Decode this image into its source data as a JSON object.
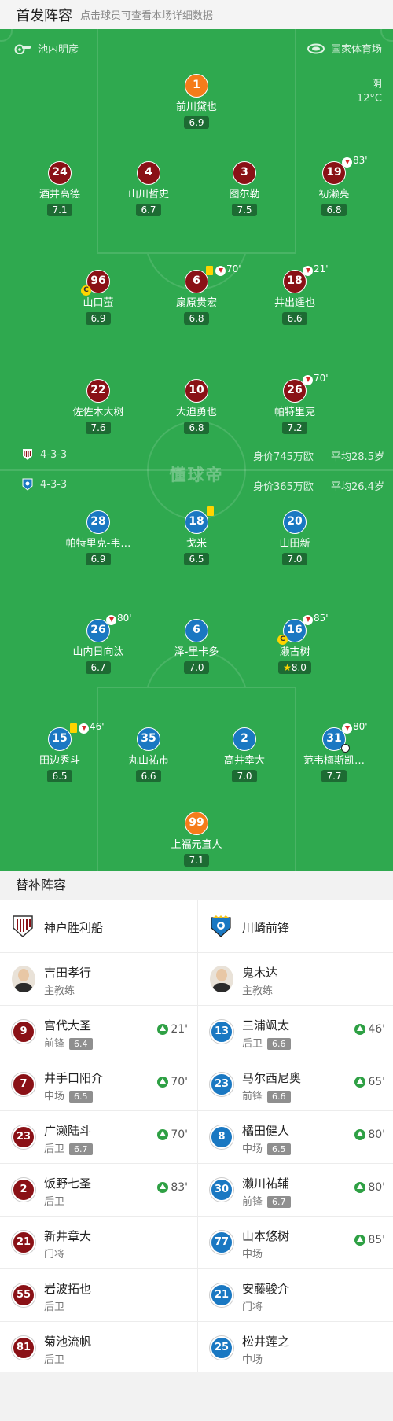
{
  "header": {
    "title": "首发阵容",
    "subtitle": "点击球员可查看本场详细数据"
  },
  "field": {
    "referee": "池内明彦",
    "stadium": "国家体育场",
    "weather": "阴",
    "temperature": "12°C",
    "home": {
      "formation": "4-3-3",
      "value": "身价745万欧",
      "age": "平均28.5岁"
    },
    "away": {
      "formation": "4-3-3",
      "value": "身价365万欧",
      "age": "平均26.4岁"
    },
    "watermark": "懂球帝"
  },
  "home_players": [
    {
      "num": "1",
      "name": "前川黛也",
      "rating": "6.9"
    },
    {
      "num": "24",
      "name": "酒井高德",
      "rating": "7.1"
    },
    {
      "num": "4",
      "name": "山川哲史",
      "rating": "6.7"
    },
    {
      "num": "3",
      "name": "图尔勒",
      "rating": "7.5"
    },
    {
      "num": "19",
      "name": "初濑亮",
      "rating": "6.8",
      "sub": "83'"
    },
    {
      "num": "96",
      "name": "山口萤",
      "rating": "6.9"
    },
    {
      "num": "6",
      "name": "扇原贵宏",
      "rating": "6.8",
      "sub": "70'"
    },
    {
      "num": "18",
      "name": "井出遥也",
      "rating": "6.6",
      "sub": "21'"
    },
    {
      "num": "22",
      "name": "佐佐木大树",
      "rating": "7.6"
    },
    {
      "num": "10",
      "name": "大迫勇也",
      "rating": "6.8"
    },
    {
      "num": "26",
      "name": "帕特里克",
      "rating": "7.2",
      "sub": "70'"
    }
  ],
  "away_players": [
    {
      "num": "28",
      "name": "帕特里克-韦…",
      "rating": "6.9"
    },
    {
      "num": "18",
      "name": "戈米",
      "rating": "6.5"
    },
    {
      "num": "20",
      "name": "山田新",
      "rating": "7.0"
    },
    {
      "num": "26",
      "name": "山内日向汰",
      "rating": "6.7",
      "sub": "80'"
    },
    {
      "num": "6",
      "name": "泽-里卡多",
      "rating": "7.0"
    },
    {
      "num": "16",
      "name": "濑古树",
      "rating": "8.0",
      "sub": "85'"
    },
    {
      "num": "15",
      "name": "田边秀斗",
      "rating": "6.5",
      "sub": "46'"
    },
    {
      "num": "35",
      "name": "丸山祐市",
      "rating": "6.6"
    },
    {
      "num": "2",
      "name": "高井幸大",
      "rating": "7.0"
    },
    {
      "num": "31",
      "name": "范韦梅斯凯…",
      "rating": "7.7",
      "sub": "80'"
    },
    {
      "num": "99",
      "name": "上福元直人",
      "rating": "7.1"
    }
  ],
  "subs_title": "替补阵容",
  "teams": {
    "home": "神户胜利船",
    "away": "川崎前锋"
  },
  "coaches": {
    "home": {
      "name": "吉田孝行",
      "role": "主教练"
    },
    "away": {
      "name": "鬼木达",
      "role": "主教练"
    }
  },
  "subs": [
    {
      "home": {
        "num": "9",
        "name": "宫代大圣",
        "pos": "前锋",
        "rating": "6.4",
        "in": "21'"
      },
      "away": {
        "num": "13",
        "name": "三浦飒太",
        "pos": "后卫",
        "rating": "6.6",
        "in": "46'"
      }
    },
    {
      "home": {
        "num": "7",
        "name": "井手口阳介",
        "pos": "中场",
        "rating": "6.5",
        "in": "70'"
      },
      "away": {
        "num": "23",
        "name": "马尔西尼奥",
        "pos": "前锋",
        "rating": "6.6",
        "in": "65'"
      }
    },
    {
      "home": {
        "num": "23",
        "name": "广濑陆斗",
        "pos": "后卫",
        "rating": "6.7",
        "in": "70'"
      },
      "away": {
        "num": "8",
        "name": "橘田健人",
        "pos": "中场",
        "rating": "6.5",
        "in": "80'"
      }
    },
    {
      "home": {
        "num": "2",
        "name": "饭野七圣",
        "pos": "后卫",
        "in": "83'"
      },
      "away": {
        "num": "30",
        "name": "濑川祐辅",
        "pos": "前锋",
        "rating": "6.7",
        "in": "80'"
      }
    },
    {
      "home": {
        "num": "21",
        "name": "新井章大",
        "pos": "门将"
      },
      "away": {
        "num": "77",
        "name": "山本悠树",
        "pos": "中场",
        "in": "85'"
      }
    },
    {
      "home": {
        "num": "55",
        "name": "岩波拓也",
        "pos": "后卫"
      },
      "away": {
        "num": "21",
        "name": "安藤骏介",
        "pos": "门将"
      }
    },
    {
      "home": {
        "num": "81",
        "name": "菊池流帆",
        "pos": "后卫"
      },
      "away": {
        "num": "25",
        "name": "松井莲之",
        "pos": "中场"
      }
    }
  ]
}
